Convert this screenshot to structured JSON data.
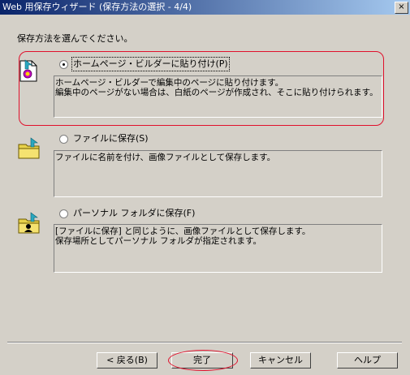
{
  "window": {
    "title": "Web 用保存ウィザード (保存方法の選択 - 4/4)",
    "close_label": "×"
  },
  "instruction": "保存方法を選んでください。",
  "options": [
    {
      "label": "ホームページ・ビルダーに貼り付け(P)",
      "checked": true,
      "icon": "homepage-builder-page-icon",
      "description": "ホームページ・ビルダーで編集中のページに貼り付けます。\n編集中のページがない場合は、白紙のページが作成され、そこに貼り付けられます。"
    },
    {
      "label": "ファイルに保存(S)",
      "checked": false,
      "icon": "folder-icon",
      "description": "ファイルに名前を付け、画像ファイルとして保存します。"
    },
    {
      "label": "パーソナル フォルダに保存(F)",
      "checked": false,
      "icon": "personal-folder-icon",
      "description": "[ファイルに保存] と同じように、画像ファイルとして保存します。\n保存場所としてパーソナル フォルダが指定されます。"
    }
  ],
  "buttons": {
    "back": "< 戻る(B)",
    "finish": "完了",
    "cancel": "キャンセル",
    "help": "ヘルプ"
  },
  "colors": {
    "titlebar_start": "#0a246a",
    "titlebar_end": "#a6caf0",
    "face": "#d4d0c8",
    "annotation": "#e0102c"
  }
}
